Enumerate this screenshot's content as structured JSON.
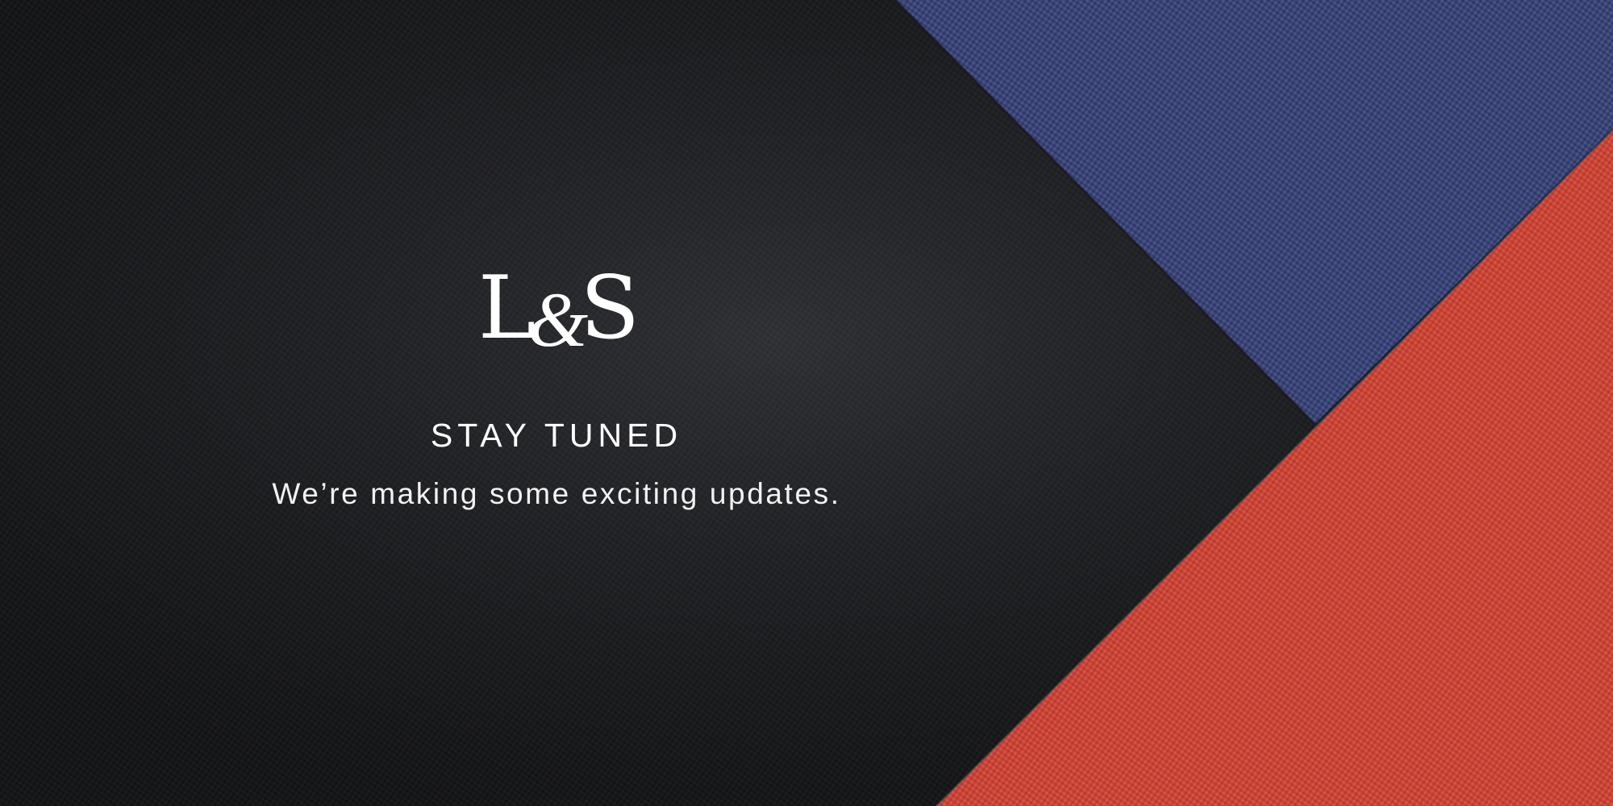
{
  "brand": {
    "logo_left": "L",
    "logo_amp": "&",
    "logo_right": "S"
  },
  "message": {
    "headline": "STAY TUNED",
    "subline": "We’re making some exciting updates."
  },
  "colors": {
    "black_panel": "#222326",
    "navy_panel": "#3a4476",
    "red_panel": "#c84436",
    "text": "#ffffff"
  },
  "background": {
    "panels": [
      "black-leather-panel",
      "navy-leather-panel",
      "red-leather-panel"
    ]
  }
}
